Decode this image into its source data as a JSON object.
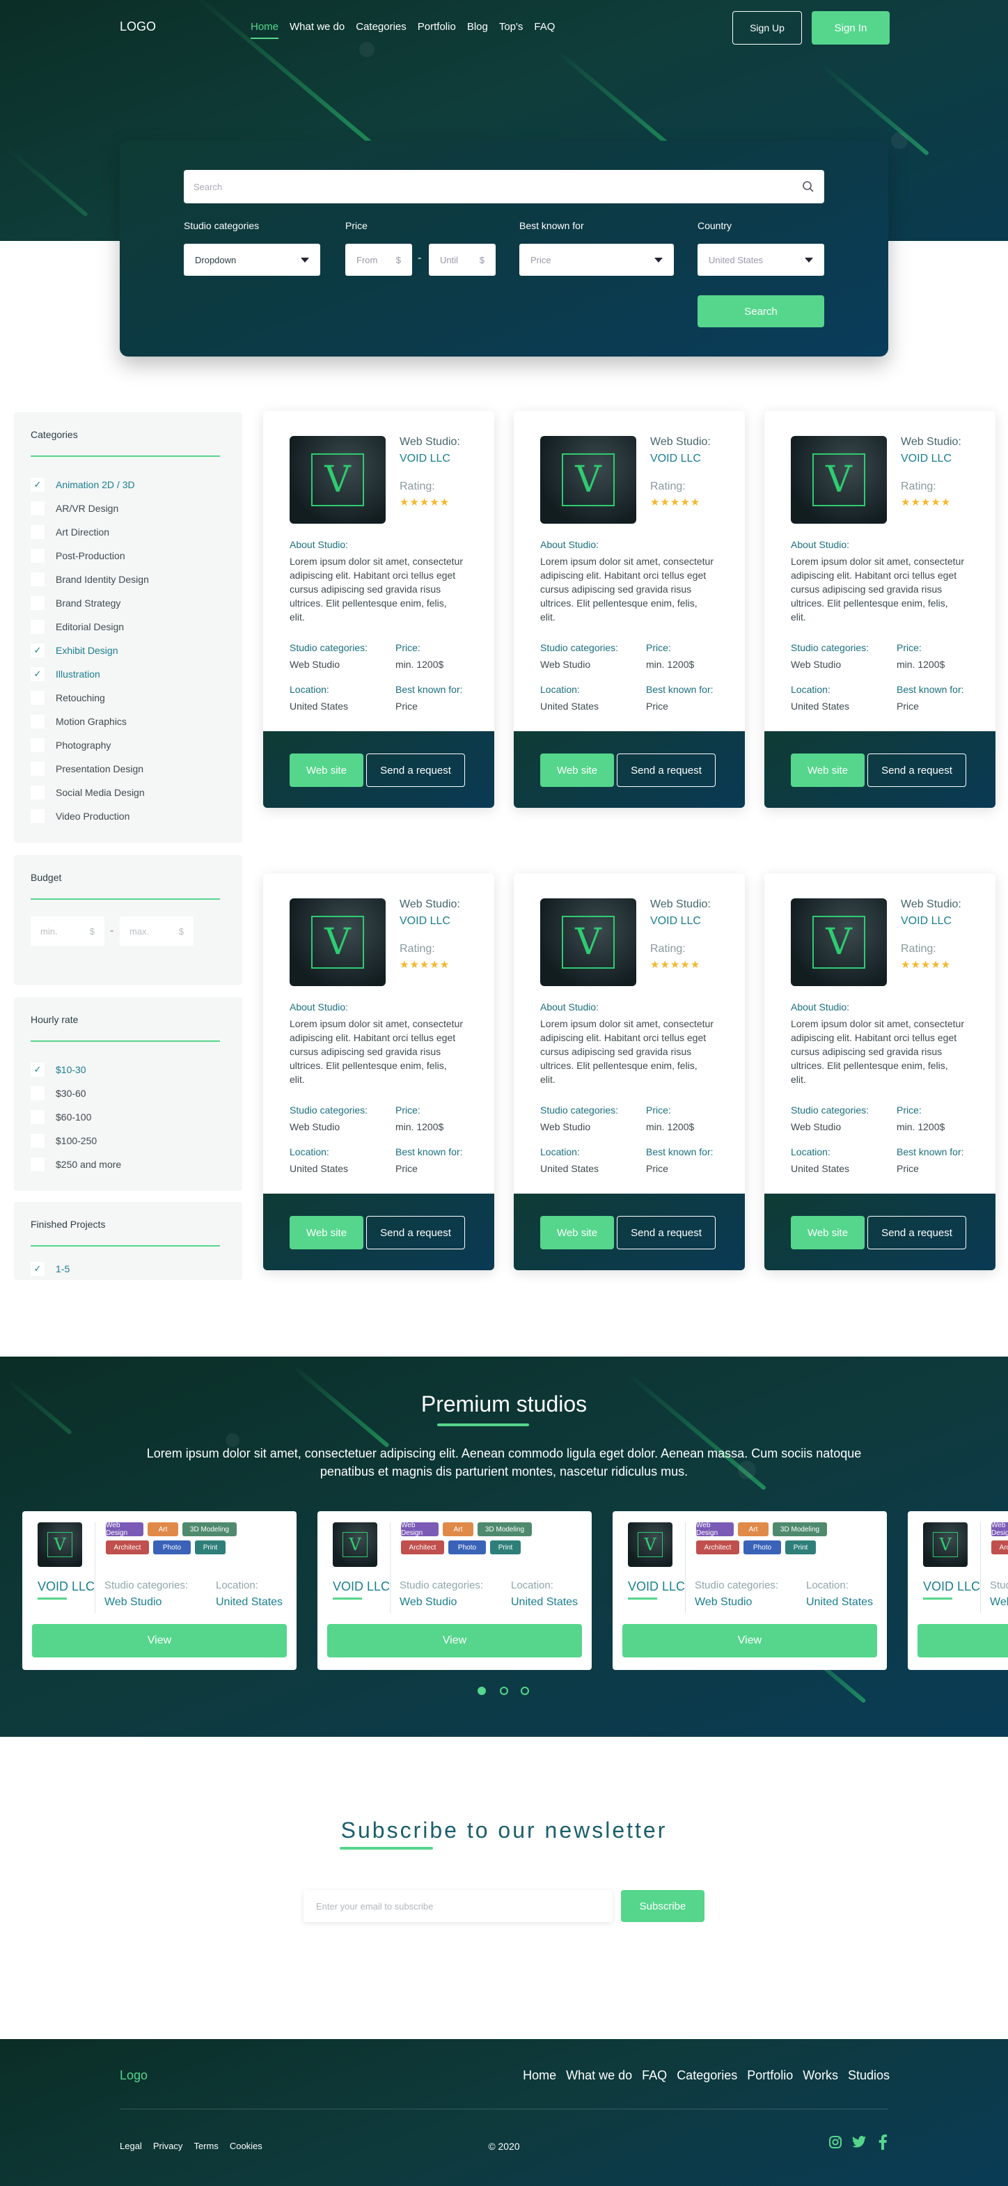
{
  "header": {
    "logo": "LOGO",
    "nav": [
      "Home",
      "What we do",
      "Categories",
      "Portfolio",
      "Blog",
      "Top's",
      "FAQ"
    ],
    "sign_up": "Sign Up",
    "sign_in": "Sign In"
  },
  "search": {
    "placeholder": "Search",
    "studio_categories_label": "Studio categories",
    "studio_categories_value": "Dropdown",
    "price_label": "Price",
    "price_from": "From",
    "price_until": "Until",
    "currency": "$",
    "best_known_label": "Best known for",
    "best_known_value": "Price",
    "country_label": "Country",
    "country_value": "United States",
    "search_button": "Search"
  },
  "sidebar": {
    "categories_title": "Categories",
    "categories": [
      {
        "label": "Animation 2D / 3D",
        "checked": true
      },
      {
        "label": "AR/VR Design",
        "checked": false
      },
      {
        "label": "Art Direction",
        "checked": false
      },
      {
        "label": "Post-Production",
        "checked": false
      },
      {
        "label": "Brand Identity Design",
        "checked": false
      },
      {
        "label": "Brand Strategy",
        "checked": false
      },
      {
        "label": "Editorial Design",
        "checked": false
      },
      {
        "label": "Exhibit Design",
        "checked": true
      },
      {
        "label": "Illustration",
        "checked": true
      },
      {
        "label": "Retouching",
        "checked": false
      },
      {
        "label": "Motion Graphics",
        "checked": false
      },
      {
        "label": "Photography",
        "checked": false
      },
      {
        "label": "Presentation Design",
        "checked": false
      },
      {
        "label": "Social Media Design",
        "checked": false
      },
      {
        "label": "Video Production",
        "checked": false
      }
    ],
    "budget_title": "Budget",
    "budget_min": "min.",
    "budget_max": "max.",
    "hourly_title": "Hourly rate",
    "hourly": [
      {
        "label": "$10-30",
        "checked": true
      },
      {
        "label": "$30-60",
        "checked": false
      },
      {
        "label": "$60-100",
        "checked": false
      },
      {
        "label": "$100-250",
        "checked": false
      },
      {
        "label": "$250 and more",
        "checked": false
      }
    ],
    "finished_title": "Finished Projects",
    "finished": [
      {
        "label": "1-5",
        "checked": true
      }
    ]
  },
  "studio_card": {
    "logo_letter": "V",
    "web_studio_label": "Web Studio:",
    "name": "VOID LLC",
    "rating_label": "Rating:",
    "stars": "★★★★★",
    "rating": 4.5,
    "about_label": "About Studio:",
    "about_text": "Lorem ipsum dolor sit amet, consectetur adipiscing elit. Habitant orci tellus eget cursus adipiscing sed gravida risus ultrices. Elit pellentesque enim, felis, elit.",
    "studio_categories_label": "Studio categories:",
    "studio_categories_value": "Web Studio",
    "price_label": "Price:",
    "price_value": "min. 1200$",
    "location_label": "Location:",
    "location_value": "United States",
    "best_known_label": "Best known for:",
    "best_known_value": "Price",
    "web_site": "Web site",
    "send_request": "Send a request"
  },
  "premium": {
    "title": "Premium studios",
    "description": "Lorem ipsum dolor sit amet, consectetuer adipiscing elit. Aenean commodo ligula eget dolor. Aenean massa. Cum sociis natoque penatibus et magnis dis parturient montes, nascetur ridiculus mus.",
    "tags": [
      "Web Design",
      "Art",
      "3D Modeling",
      "Architect",
      "Photo",
      "Print"
    ],
    "tag_colors": [
      "#7b5bb6",
      "#e08a4a",
      "#4f8a6e",
      "#c0504d",
      "#3a63b8",
      "#2e7f7a"
    ],
    "name": "VOID LLC",
    "studio_categories_label": "Studio categories:",
    "studio_categories_value": "Web Studio",
    "location_label": "Location:",
    "location_value": "United States",
    "view": "View"
  },
  "newsletter": {
    "title": "Subscribe to our newsletter",
    "placeholder": "Enter your email to subscribe",
    "button": "Subscribe"
  },
  "footer": {
    "logo": "Logo",
    "nav": [
      "Home",
      "What we do",
      "FAQ",
      "Categories",
      "Portfolio",
      "Works",
      "Studios"
    ],
    "legal": [
      "Legal",
      "Privacy",
      "Terms",
      "Cookies"
    ],
    "copyright": "© 2020",
    "social": [
      "instagram-icon",
      "twitter-icon",
      "facebook-icon"
    ]
  },
  "colors": {
    "accent": "#55d68c",
    "teal": "#1a7f8f",
    "dark": "#0e3a3c"
  }
}
